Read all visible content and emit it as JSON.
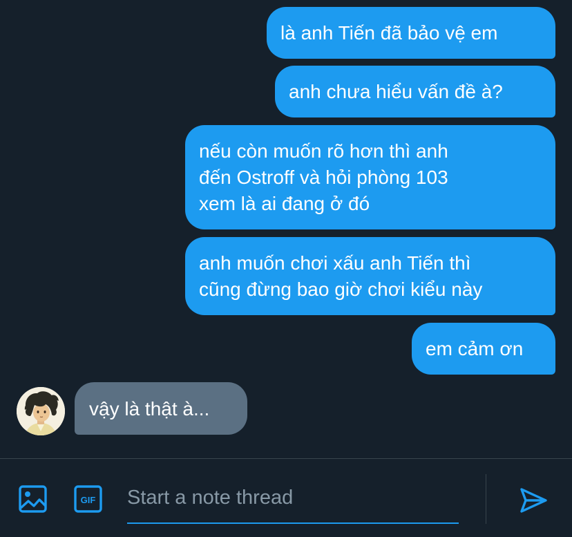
{
  "conversation": {
    "messages": [
      {
        "direction": "sent",
        "text": "là anh Tiến đã bảo vệ em"
      },
      {
        "direction": "sent",
        "text": "anh chưa hiểu vấn đề à?"
      },
      {
        "direction": "sent",
        "text": "nếu còn muốn rõ hơn thì anh\nđến Ostroff và hỏi phòng 103\nxem là ai đang ở đó"
      },
      {
        "direction": "sent",
        "text": "anh muốn chơi xấu anh Tiến thì\ncũng đừng bao giờ chơi kiểu này"
      },
      {
        "direction": "sent",
        "text": "em cảm ơn"
      },
      {
        "direction": "received",
        "text": "vậy là thật à..."
      }
    ],
    "avatar_icon": "avatar-illustration-icon"
  },
  "composer": {
    "placeholder": "Start a note thread",
    "value": "",
    "gif_label": "GIF",
    "media_icon": "image-icon",
    "send_icon": "send-icon"
  },
  "colors": {
    "background": "#15202b",
    "sent_bubble": "#1d9bf0",
    "received_bubble": "#5b7083",
    "accent": "#1d9bf0",
    "placeholder": "#8899a6",
    "divider": "#38444d"
  }
}
